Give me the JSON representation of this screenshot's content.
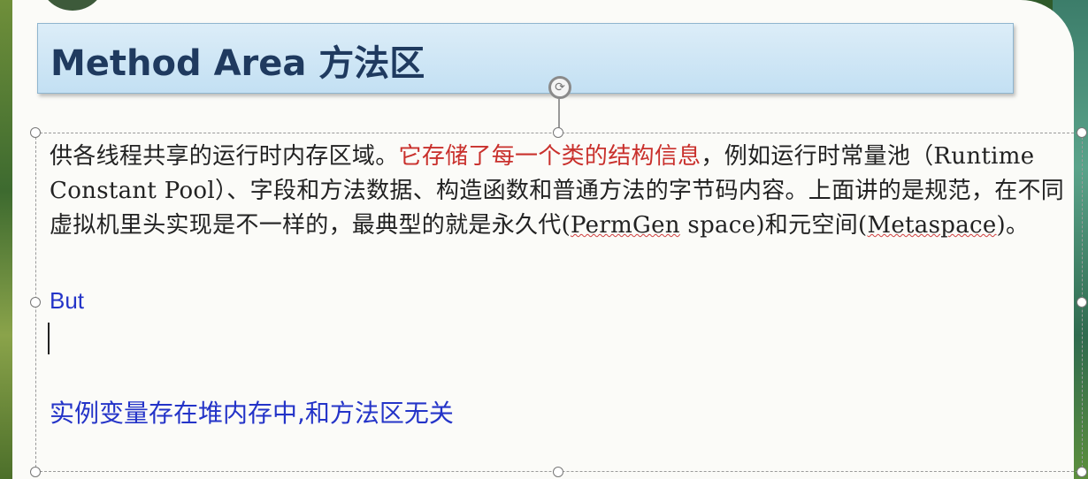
{
  "header": {
    "logo_text": "",
    "title": "Method Area 方法区"
  },
  "content": {
    "para_part1": "供各线程共享的运行时内存区域。",
    "para_highlight": "它存储了每一个类的结构信息",
    "para_part2": "，例如运行时常量池（Runtime Constant Pool）、字段和方法数据、构造函数和普通方法的字节码内容。上面讲的是规范，在不同虚拟机里头实现是不一样的，最典型的就是永久代(",
    "permgen": "PermGen",
    "para_part3": " space)和元空间(",
    "metaspace": "Metaspace",
    "para_part4": ")。",
    "but_label": "But",
    "note": "实例变量存在堆内存中,和方法区无关"
  },
  "colors": {
    "highlight_red": "#c9302c",
    "blue_text": "#2434c8",
    "title_blue": "#1f3a5f"
  },
  "icons": {
    "rotate": "rotate-handle-icon"
  }
}
